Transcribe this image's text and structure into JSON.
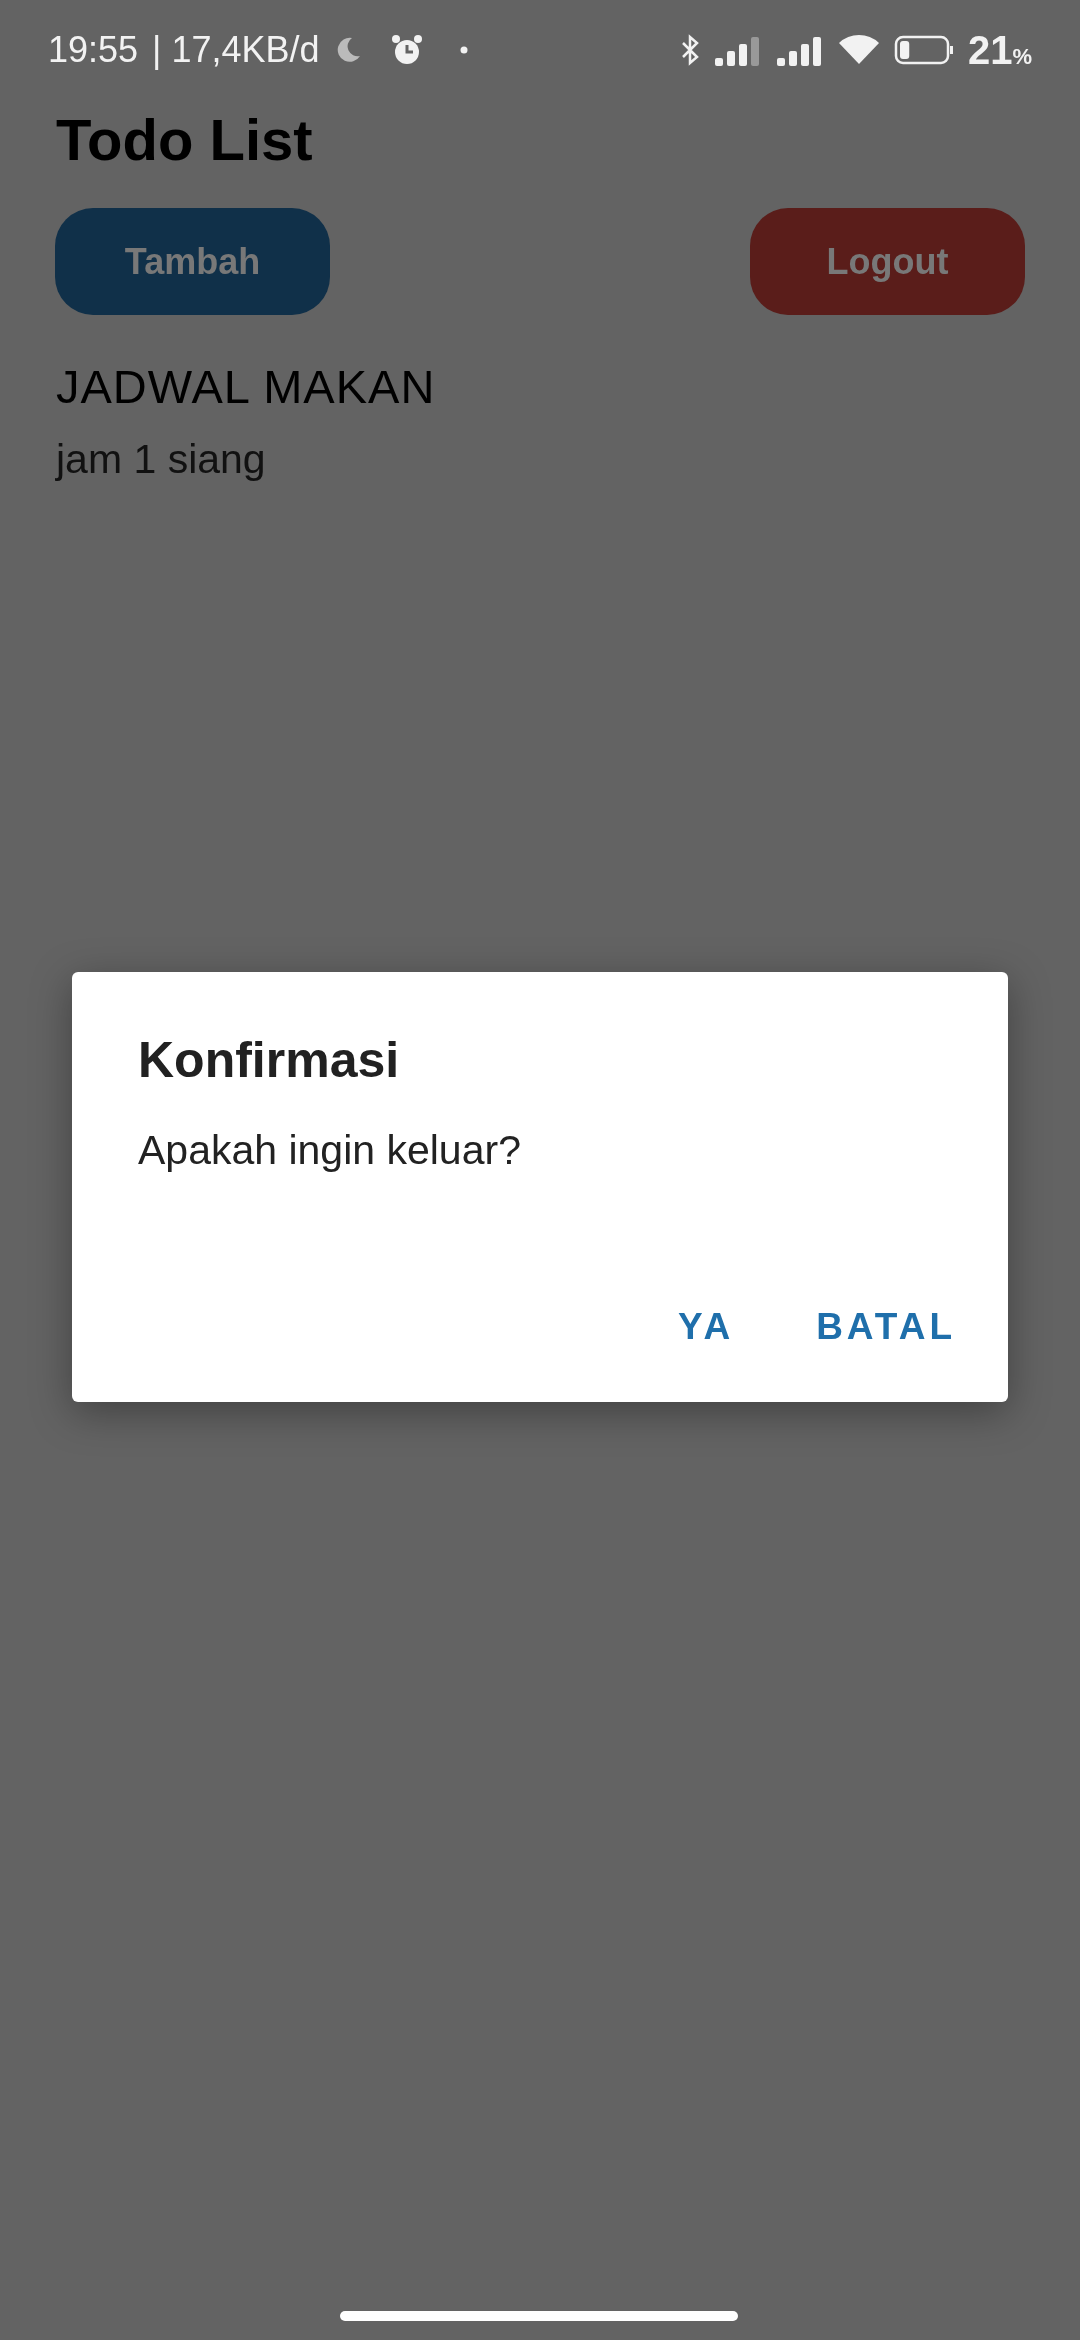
{
  "status_bar": {
    "time": "19:55",
    "network_speed": "| 17,4KB/d",
    "battery": "21",
    "battery_unit": "%"
  },
  "app_title": "Todo List",
  "buttons": [
    {
      "label": "Tambah",
      "kind": "primary"
    },
    {
      "label": "Logout",
      "kind": "danger"
    }
  ],
  "todos": [
    {
      "title": "JADWAL MAKAN",
      "subtitle": "jam 1 siang"
    }
  ],
  "dialog": {
    "title": "Konfirmasi",
    "message": "Apakah ingin keluar?",
    "actions": [
      "YA",
      "BATAL"
    ]
  }
}
